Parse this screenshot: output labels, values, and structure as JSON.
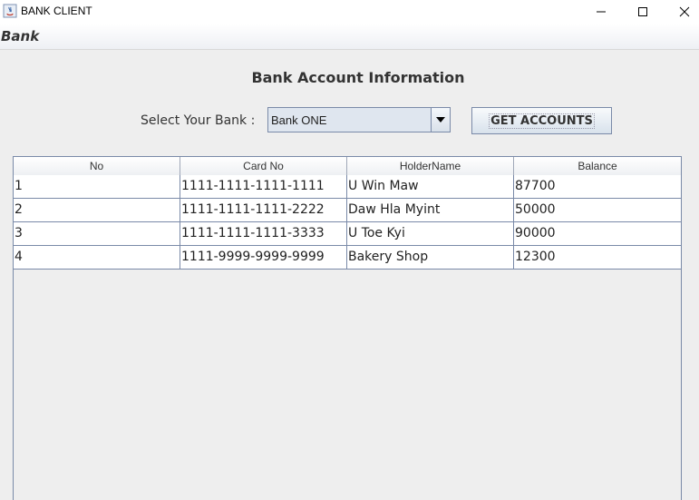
{
  "window": {
    "title": "BANK CLIENT",
    "controls": [
      "minimize-icon",
      "maximize-icon",
      "close-icon"
    ]
  },
  "menu": {
    "label": "Bank"
  },
  "main": {
    "heading": "Bank Account Information",
    "select_label": "Select Your Bank :",
    "bank_select": {
      "selected": "Bank ONE"
    },
    "get_button_label": "GET ACCOUNTS"
  },
  "table": {
    "columns": [
      "No",
      "Card No",
      "HolderName",
      "Balance"
    ],
    "rows": [
      [
        "1",
        "1111-1111-1111-1111",
        "U Win Maw",
        "87700"
      ],
      [
        "2",
        "1111-1111-1111-2222",
        "Daw Hla Myint",
        "50000"
      ],
      [
        "3",
        "1111-1111-1111-3333",
        "U Toe Kyi",
        "90000"
      ],
      [
        "4",
        "1111-9999-9999-9999",
        "Bakery Shop",
        "12300"
      ]
    ]
  },
  "colors": {
    "background": "#eeeeee",
    "border": "#7a8aa8",
    "button_gradient_top": "#f8fafc",
    "button_gradient_bottom": "#d8e2ec"
  }
}
